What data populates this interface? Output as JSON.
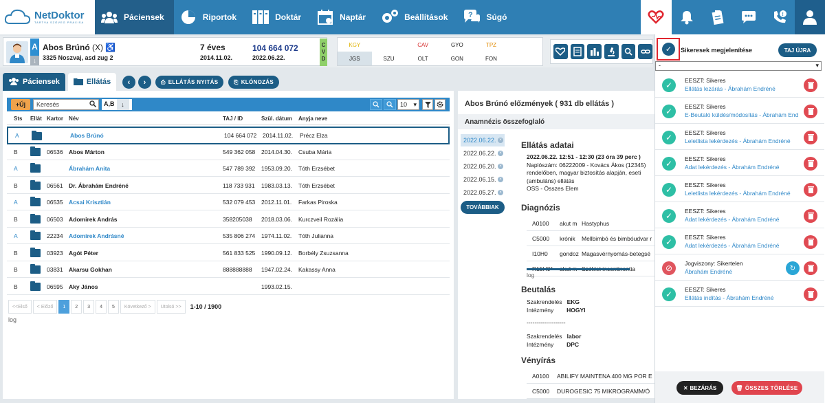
{
  "nav": {
    "brand": "NetDoktor",
    "brand_tagline": "TARTVA SZÖVEG PRAXISA",
    "items": [
      {
        "label": "Páciensek",
        "icon": "users-icon"
      },
      {
        "label": "Riportok",
        "icon": "pie-chart-icon"
      },
      {
        "label": "Doktár",
        "icon": "binders-icon"
      },
      {
        "label": "Naptár",
        "icon": "calendar-icon"
      },
      {
        "label": "Beállítások",
        "icon": "gears-icon"
      },
      {
        "label": "Súgó",
        "icon": "help-chat-icon"
      }
    ],
    "icons": [
      "eeszt-heart-icon",
      "bell-icon",
      "clipboard-icon",
      "chat-icon",
      "phone-alert-icon",
      "user-icon"
    ],
    "colors": {
      "nav": "#2f7fb4",
      "active": "#235f8a",
      "accent": "#1c5d86"
    }
  },
  "patient": {
    "badge": "A",
    "name": "Abos Brúnó",
    "suffix": "(X)",
    "address": "3325 Noszvaj, asd zug 2",
    "age": "7 éves",
    "dob": "2014.11.02.",
    "taj": "104 664 072",
    "date": "2022.06.22.",
    "cvd": [
      "C",
      "V",
      "D"
    ]
  },
  "codes": [
    [
      {
        "label": "KGY",
        "color": "#e0b200"
      },
      {
        "label": "",
        "color": "#bbb"
      },
      {
        "label": "CAV",
        "color": "#d62d2d"
      },
      {
        "label": "GYO",
        "color": "#222"
      },
      {
        "label": "TPZ",
        "color": "#e08a00"
      },
      {
        "label": "",
        "color": "#bbb"
      }
    ],
    [
      {
        "label": "JGS",
        "color": "#222"
      },
      {
        "label": "SZU",
        "color": "#222"
      },
      {
        "label": "OLT",
        "color": "#222"
      },
      {
        "label": "GON",
        "color": "#222"
      },
      {
        "label": "FON",
        "color": "#222"
      },
      {
        "label": "",
        "color": "#bbb"
      }
    ]
  ],
  "action_icons": [
    "heart-monitor-icon",
    "document-icon",
    "chart-icon",
    "microscope-icon",
    "search-zoom-icon",
    "link-icon"
  ],
  "tabs": {
    "pacients": "Páciensek",
    "ellatas": "Ellátás"
  },
  "buttons": {
    "prev": "‹",
    "next": "›",
    "open": "ELLÁTÁS NYITÁS",
    "clone": "KLÓNOZÁS",
    "plus": "+Új",
    "sort": "A,B",
    "perpage": "10",
    "tovabbiak": "TOVÁBBIAK",
    "taj_ujra": "TAJ ÚJRA",
    "bezaras": "BEZÁRÁS",
    "osszes": "ÖSSZES TÖRLÉSE"
  },
  "search": {
    "placeholder": "Keresés"
  },
  "table": {
    "headers": [
      "Sts",
      "Ellát",
      "Kartor",
      "Név",
      "TAJ / ID",
      "Szül. dátum",
      "Anyja neve"
    ],
    "rows": [
      {
        "sts": "A",
        "kartor": "",
        "name": "Abos Brúnó",
        "taj": "104 664 072",
        "dob": "2014.11.02.",
        "mother": "Précz Elza",
        "blue": true,
        "selected": true
      },
      {
        "sts": "B",
        "kartor": "06536",
        "name": "Abos Márton",
        "taj": "549 362 058",
        "dob": "2014.04.30.",
        "mother": "Csuba Mária",
        "blue": false,
        "selected": false
      },
      {
        "sts": "A",
        "kartor": "",
        "name": "Ábrahám Anita",
        "taj": "547 789 392",
        "dob": "1953.09.20.",
        "mother": "Tóth Erzsébet",
        "blue": true,
        "selected": false
      },
      {
        "sts": "B",
        "kartor": "06561",
        "name": "Dr. Ábrahám Endréné",
        "taj": "118 733 931",
        "dob": "1983.03.13.",
        "mother": "Tóth Erzsébet",
        "blue": false,
        "selected": false
      },
      {
        "sts": "A",
        "kartor": "06535",
        "name": "Acsai Krisztián",
        "taj": "532 079 453",
        "dob": "2012.11.01.",
        "mother": "Farkas Piroska",
        "blue": true,
        "selected": false
      },
      {
        "sts": "B",
        "kartor": "06503",
        "name": "Adomirek András",
        "taj": "358205038",
        "dob": "2018.03.06.",
        "mother": "Kurczveil Rozália",
        "blue": false,
        "selected": false
      },
      {
        "sts": "A",
        "kartor": "22234",
        "name": "Adomirek Andrásné",
        "taj": "535 806 274",
        "dob": "1974.11.02.",
        "mother": "Tóth Julianna",
        "blue": true,
        "selected": false
      },
      {
        "sts": "B",
        "kartor": "03923",
        "name": "Agót Péter",
        "taj": "561 833 525",
        "dob": "1990.09.12.",
        "mother": "Borbély Zsuzsanna",
        "blue": false,
        "selected": false
      },
      {
        "sts": "B",
        "kartor": "03831",
        "name": "Akarsu Gokhan",
        "taj": "888888888",
        "dob": "1947.02.24.",
        "mother": "Kakassy Anna",
        "blue": false,
        "selected": false
      },
      {
        "sts": "B",
        "kartor": "06595",
        "name": "Aky János",
        "taj": "",
        "dob": "1993.02.15.",
        "mother": "",
        "blue": false,
        "selected": false
      }
    ]
  },
  "pager": {
    "items": [
      "<<Első",
      "< Előző",
      "1",
      "2",
      "3",
      "4",
      "5",
      "Következő >",
      "Utolsó >>"
    ],
    "current": "1",
    "total": "1-10 / 1900",
    "log": "log"
  },
  "history": {
    "title": "Abos Brúnó előzmények ( 931 db ellátás )",
    "subtitle": "Anamnézis összefoglaló",
    "dates": [
      "2022.06.22.",
      "2022.06.22.",
      "2022.06.20.",
      "2022.06.15.",
      "2022.05.27."
    ],
    "care_title": "Ellátás adatai",
    "care_lines": [
      "2022.06.22. 12:51 - 12:30 (23 óra 39 perc )",
      "Naplószám: 06222009 - Kovács Ákos (12345)",
      "rendelőben, magyar biztosítás alapján, eseti",
      "(ambuláns) ellátás",
      "OSS - Összes Elem"
    ],
    "diag_title": "Diagnózis",
    "diagnoses": [
      {
        "code": "A0100",
        "type": "akut m",
        "desc": "Hastyphus"
      },
      {
        "code": "C5000",
        "type": "krónik",
        "desc": "Mellbimbó és bimbóudvar r"
      },
      {
        "code": "I10H0",
        "type": "gondoz",
        "desc": "Magasvérnyomás-betegsé"
      },
      {
        "code": "R15H0*",
        "type": "akut m",
        "desc": "Széklet incontinentia"
      }
    ],
    "log": "log",
    "ref_title": "Beutalás",
    "ref1": {
      "k1": "Szakrendelés",
      "v1": "EKG",
      "k2": "Intézmény",
      "v2": "HOGYI"
    },
    "divider": "--------------------",
    "ref2": {
      "k1": "Szakrendelés",
      "v1": "labor",
      "k2": "Intézmény",
      "v2": "DPC"
    },
    "rx_title": "Vényírás",
    "rx": [
      {
        "code": "A0100",
        "desc": "ABILIFY MAINTENA 400 MG POR E"
      },
      {
        "code": "C5000",
        "desc": "DUROGESIC 75 MIKROGRAMM/Ó"
      }
    ]
  },
  "eeszt": {
    "show_success": "Sikeresek megjelenítése",
    "select_value": "-",
    "items": [
      {
        "status": "EESZT: Sikeres",
        "detail": "Ellátás lezárás - Ábrahám Endréné",
        "ok": true
      },
      {
        "status": "EESZT: Sikeres",
        "detail": "E-Beutaló küldés/módosítás - Ábrahám Endréné",
        "ok": true
      },
      {
        "status": "EESZT: Sikeres",
        "detail": "Leletlista lekérdezés - Ábrahám Endréné",
        "ok": true
      },
      {
        "status": "EESZT: Sikeres",
        "detail": "Adat lekérdezés - Ábrahám Endréné",
        "ok": true
      },
      {
        "status": "EESZT: Sikeres",
        "detail": "Leletlista lekérdezés - Ábrahám Endréné",
        "ok": true
      },
      {
        "status": "EESZT: Sikeres",
        "detail": "Adat lekérdezés - Ábrahám Endréné",
        "ok": true
      },
      {
        "status": "EESZT: Sikeres",
        "detail": "Adat lekérdezés - Ábrahám Endréné",
        "ok": true
      },
      {
        "status": "Jogviszony: Sikertelen",
        "detail": "Ábrahám Endréné",
        "ok": false
      },
      {
        "status": "EESZT: Sikeres",
        "detail": "Ellátás indítás - Ábrahám Endréné",
        "ok": true
      }
    ]
  }
}
